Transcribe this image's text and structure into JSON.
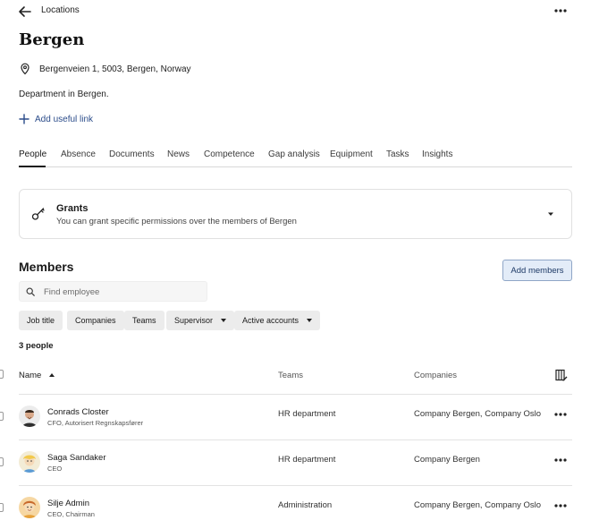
{
  "header": {
    "breadcrumb": "Locations"
  },
  "location": {
    "name": "Bergen",
    "address": "Bergenveien 1, 5003, Bergen, Norway",
    "description": "Department in Bergen.",
    "add_link_label": "Add useful link"
  },
  "tabs": [
    {
      "label": "People",
      "active": true
    },
    {
      "label": "Absence"
    },
    {
      "label": "Documents"
    },
    {
      "label": "News"
    },
    {
      "label": "Competence"
    },
    {
      "label": "Gap analysis"
    },
    {
      "label": "Equipment"
    },
    {
      "label": "Tasks"
    },
    {
      "label": "Insights"
    }
  ],
  "grants": {
    "title": "Grants",
    "subtitle": "You can grant specific permissions over the members of Bergen"
  },
  "members": {
    "heading": "Members",
    "add_button": "Add members",
    "search_placeholder": "Find employee",
    "filters": [
      "Job title",
      "Companies",
      "Teams",
      "Supervisor",
      "Active accounts"
    ],
    "count": "3 people",
    "columns": {
      "name": "Name",
      "teams": "Teams",
      "companies": "Companies"
    },
    "rows": [
      {
        "name": "Conrads Closter",
        "title": "CFO, Autorisert Regnskapsfører",
        "team": "HR department",
        "companies": "Company Bergen, Company Oslo"
      },
      {
        "name": "Saga Sandaker",
        "title": "CEO",
        "team": "HR department",
        "companies": "Company Bergen"
      },
      {
        "name": "Silje Admin",
        "title": "CEO, Chairman",
        "team": "Administration",
        "companies": "Company Bergen, Company Oslo"
      }
    ]
  },
  "colors": {
    "link": "#2b4c8a",
    "primary_button_bg": "#e3ecf8",
    "primary_button_border": "#8fa6c7"
  }
}
